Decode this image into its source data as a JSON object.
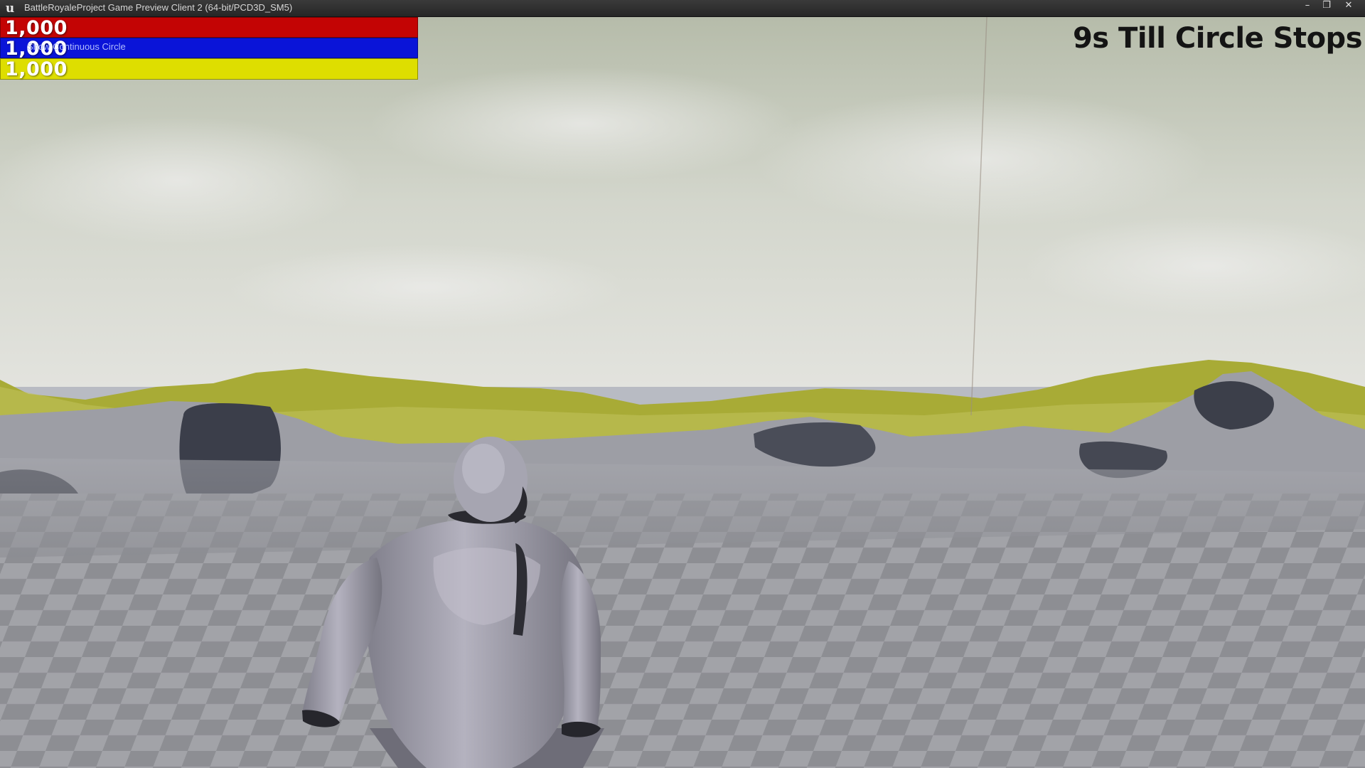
{
  "window": {
    "title": "BattleRoyaleProject Game Preview Client 2 (64-bit/PCD3D_SM5)",
    "logo_icon": "unreal-engine-logo",
    "controls": {
      "minimize_icon": "minimize-icon",
      "maximize_icon": "restore-icon",
      "close_icon": "close-icon"
    }
  },
  "hud": {
    "health": {
      "value": "1,000",
      "color": "#c30404",
      "fill": 1.0
    },
    "shield": {
      "value": "1,000",
      "color": "#0a14d8",
      "fill": 1.0
    },
    "stamina": {
      "value": "1,000",
      "color": "#dede00",
      "fill": 1.0
    },
    "debug_message": "Show Continuous Circle",
    "circle_timer": "9s Till Circle Stops"
  },
  "scene": {
    "sky_color": "#c8cdbd",
    "hills_color": "#a9ac3a",
    "ground_color": "#8f9096",
    "character": "mannequin-character"
  }
}
